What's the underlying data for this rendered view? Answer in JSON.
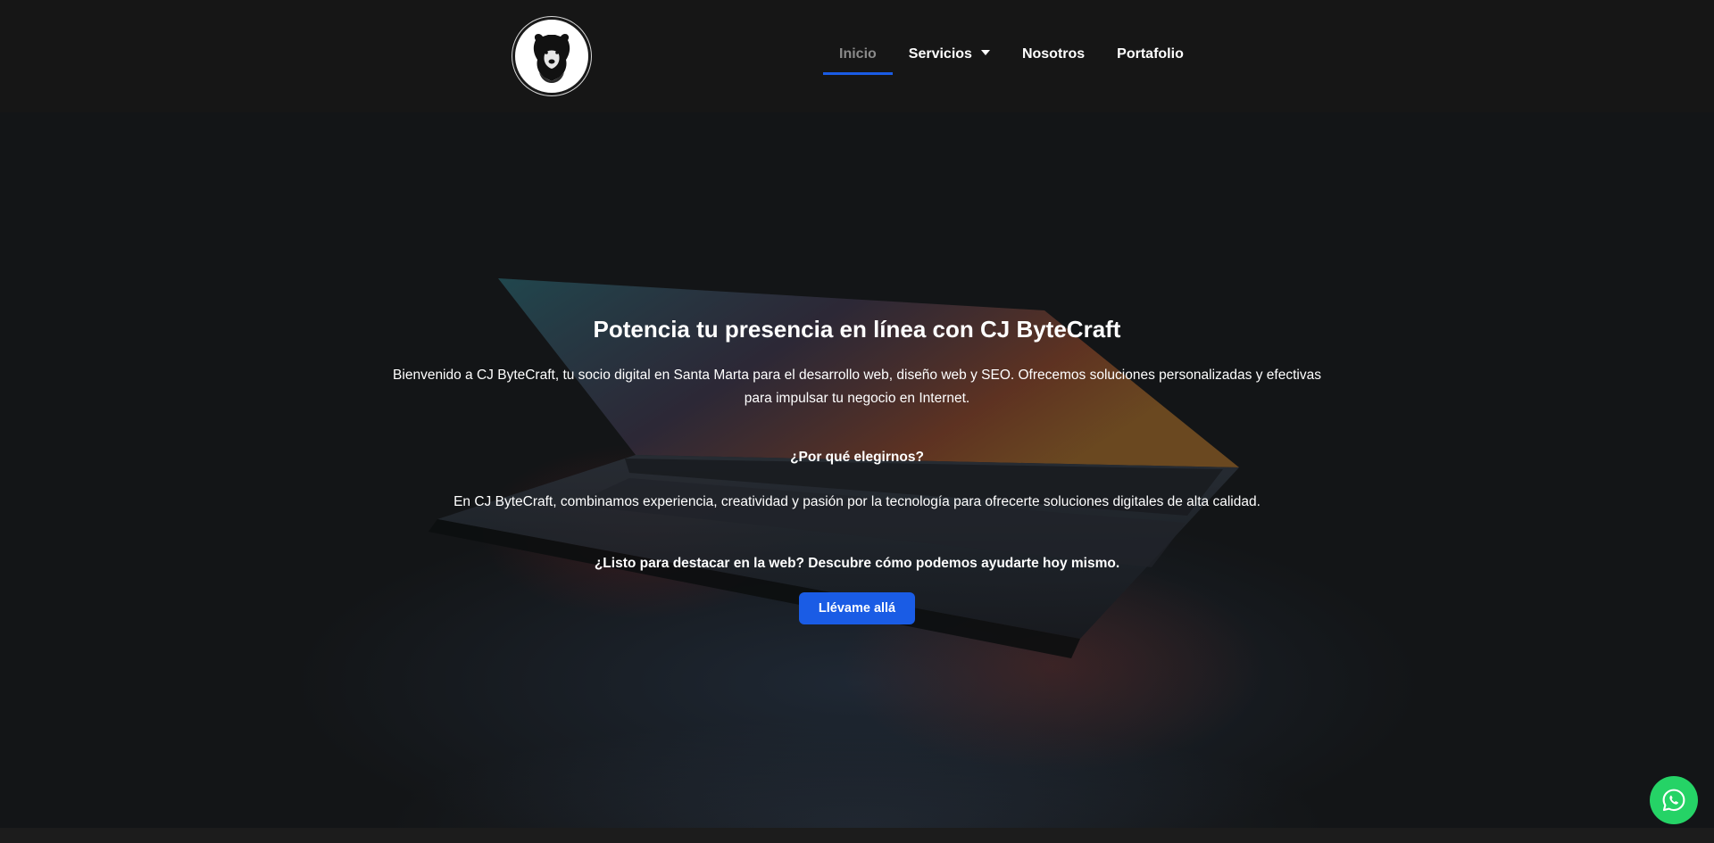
{
  "header": {
    "logo_name": "bear-logo",
    "nav": [
      {
        "label": "Inicio",
        "active": true
      },
      {
        "label": "Servicios",
        "has_dropdown": true
      },
      {
        "label": "Nosotros"
      },
      {
        "label": "Portafolio"
      }
    ]
  },
  "hero": {
    "title": "Potencia tu presencia en línea con CJ ByteCraft",
    "intro": "Bienvenido a CJ ByteCraft, tu socio digital en Santa Marta para el desarrollo web, diseño web y SEO. Ofrecemos soluciones personalizadas y efectivas para impulsar tu negocio en Internet.",
    "why_heading": "¿Por qué elegirnos?",
    "why_text": "En CJ ByteCraft, combinamos experiencia, creatividad y pasión por la tecnología para ofrecerte soluciones digitales de alta calidad.",
    "cta_question": "¿Listo para destacar en la web? Descubre cómo podemos ayudarte hoy mismo.",
    "cta_label": "Llévame allá",
    "background": "laptop-photo"
  },
  "floating": {
    "whatsapp_icon": "whatsapp-icon"
  },
  "colors": {
    "accent": "#1a5ce5",
    "header_bg": "#161616",
    "whatsapp": "#25d366",
    "nav_active": "#8a8a8a"
  }
}
